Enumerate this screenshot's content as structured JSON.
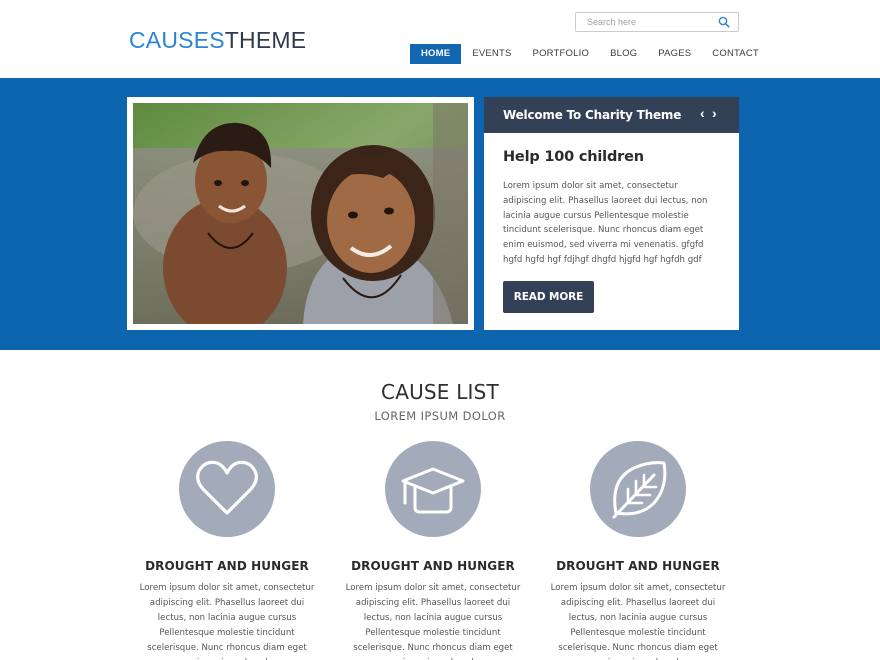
{
  "header": {
    "logo_part1": "CAUSES",
    "logo_part2": "THEME",
    "search_placeholder": "Search here",
    "nav": [
      "HOME",
      "EVENTS",
      "PORTFOLIO",
      "BLOG",
      "PAGES",
      "CONTACT"
    ],
    "active_nav": "HOME"
  },
  "hero": {
    "slide_title": "Welcome To Charity Theme",
    "prev_icon": "chevron-left-icon",
    "next_icon": "chevron-right-icon",
    "heading": "Help 100 children",
    "text": "Lorem ipsum dolor sit amet, consectetur adipiscing elit. Phasellus laoreet dui lectus, non lacinia augue cursus Pellentesque molestie tincidunt scelerisque. Nunc rhoncus diam eget enim euismod, sed viverra mi venenatis. gfgfd hgfd hgfd hgf fdjhgf dhgfd hjgfd hgf hgfdh gdf",
    "button": "READ MORE"
  },
  "causes": {
    "title": "CAUSE LIST",
    "subtitle": "LOREM IPSUM DOLOR",
    "items": [
      {
        "icon": "heart-icon",
        "title": "DROUGHT AND HUNGER",
        "text": "Lorem ipsum dolor sit amet, consectetur adipiscing elit. Phasellus laoreet dui lectus, non lacinia augue cursus Pellentesque molestie tincidunt scelerisque. Nunc rhoncus diam eget enim euismod, sed"
      },
      {
        "icon": "graduation-cap-icon",
        "title": "DROUGHT AND HUNGER",
        "text": "Lorem ipsum dolor sit amet, consectetur adipiscing elit. Phasellus laoreet dui lectus, non lacinia augue cursus Pellentesque molestie tincidunt scelerisque. Nunc rhoncus diam eget enim euismod, sed"
      },
      {
        "icon": "leaf-icon",
        "title": "DROUGHT AND HUNGER",
        "text": "Lorem ipsum dolor sit amet, consectetur adipiscing elit. Phasellus laoreet dui lectus, non lacinia augue cursus Pellentesque molestie tincidunt scelerisque. Nunc rhoncus diam eget enim euismod, sed"
      }
    ]
  },
  "colors": {
    "brand_blue": "#0d65b0",
    "logo_blue": "#2a86d1",
    "dark_slate": "#334157",
    "icon_circle": "#a3abbb"
  }
}
